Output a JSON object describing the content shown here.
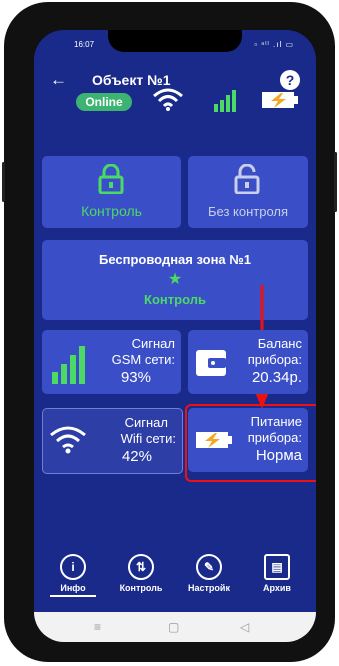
{
  "status": {
    "time": "16:07",
    "icons": "▫ ⁿˡˡ .ıl ▭"
  },
  "header": {
    "back": "←",
    "title": "Объект №1",
    "help": "?"
  },
  "indicators": {
    "online": "Online",
    "wifi_icon": "wifi-icon",
    "gsm_icon": "signal-bars-icon",
    "battery_icon": "battery-charging-icon"
  },
  "security": {
    "control_label": "Контроль",
    "no_control_label": "Без контроля"
  },
  "zone": {
    "title": "Беспроводная зона №1",
    "star": "★",
    "status": "Контроль"
  },
  "gsm": {
    "line1": "Сигнал",
    "line2": "GSM сети:",
    "value": "93%"
  },
  "balance": {
    "line1": "Баланс",
    "line2": "прибора:",
    "value": "20.34р."
  },
  "wifi": {
    "line1": "Сигнал",
    "line2": "Wifi сети:",
    "value": "42%"
  },
  "power": {
    "line1": "Питание",
    "line2": "прибора:",
    "value": "Норма"
  },
  "nav": [
    {
      "icon": "i",
      "label": "Инфо"
    },
    {
      "icon": "⇅",
      "label": "Контроль"
    },
    {
      "icon": "✎",
      "label": "Настройк"
    },
    {
      "icon": "▤",
      "label": "Архив"
    }
  ],
  "sysnav": {
    "menu": "≡",
    "home": "▢",
    "back": "◁"
  },
  "colors": {
    "background": "#1a2a8a",
    "card": "#3a4fc7",
    "accent_green": "#4cd964",
    "highlight": "#e11111",
    "arrow": "#e11111"
  }
}
